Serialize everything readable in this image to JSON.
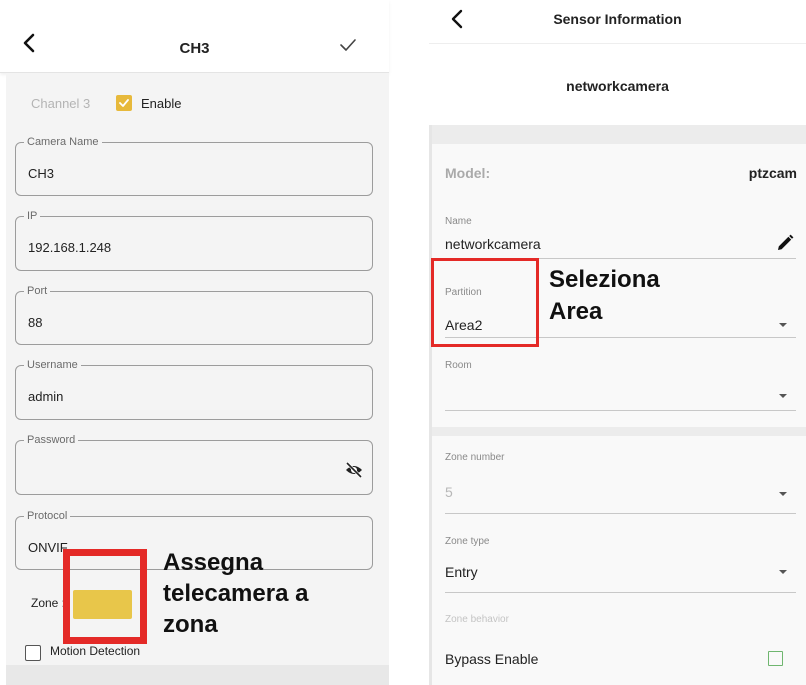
{
  "left": {
    "title": "CH3",
    "channel_label": "Channel 3",
    "enable_label": "Enable",
    "fields": [
      {
        "key": "camera_name",
        "label": "Camera Name",
        "value": "CH3"
      },
      {
        "key": "ip",
        "label": "IP",
        "value": "192.168.1.248"
      },
      {
        "key": "port",
        "label": "Port",
        "value": "88"
      },
      {
        "key": "username",
        "label": "Username",
        "value": "admin"
      },
      {
        "key": "password",
        "label": "Password",
        "value": ""
      },
      {
        "key": "protocol",
        "label": "Protocol",
        "value": "ONVIF"
      }
    ],
    "zone_label": "Zone :",
    "motion_detection_label": "Motion Detection",
    "annotation": [
      "Assegna",
      "telecamera a",
      "zona"
    ]
  },
  "right": {
    "title": "Sensor Information",
    "device_name": "networkcamera",
    "model_label": "Model:",
    "model_value": "ptzcam",
    "name_label": "Name",
    "name_value": "networkcamera",
    "partition_label": "Partition",
    "partition_value": "Area2",
    "room_label": "Room",
    "room_value": "",
    "zone_number_label": "Zone number",
    "zone_number_value": "5",
    "zone_type_label": "Zone type",
    "zone_type_value": "Entry",
    "zone_behavior_label": "Zone behavior",
    "bypass_label": "Bypass Enable",
    "annotation": [
      "Seleziona",
      "Area"
    ]
  },
  "colors": {
    "highlight_red": "#e42a27",
    "checkbox_yellow": "#e7b93b",
    "zone_select_yellow": "#e8c64a"
  },
  "icons": {
    "left_back": "chevron-left-icon",
    "left_confirm": "check-icon",
    "password_visibility": "eye-off-icon",
    "right_back": "chevron-left-icon",
    "name_edit": "pencil-icon"
  }
}
